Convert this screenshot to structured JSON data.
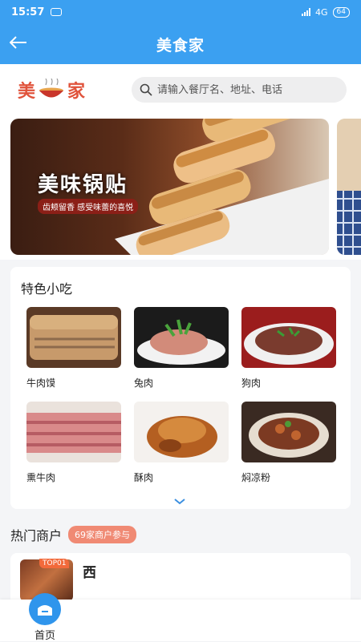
{
  "status_bar": {
    "time": "15:57",
    "network": "4G",
    "battery": "64"
  },
  "app": {
    "title": "美食家"
  },
  "logo": {
    "left": "美",
    "right": "家"
  },
  "search": {
    "placeholder": "请输入餐厅名、地址、电话"
  },
  "banner": {
    "title": "美味锅贴",
    "subtitle": "齿颊留香 感受味蕾的喜悦"
  },
  "snacks": {
    "title": "特色小吃",
    "items": [
      {
        "label": "牛肉馍",
        "icon": "beef-bun-photo"
      },
      {
        "label": "兔肉",
        "icon": "rabbit-meat-photo"
      },
      {
        "label": "狗肉",
        "icon": "dog-meat-photo"
      },
      {
        "label": "熏牛肉",
        "icon": "smoked-beef-photo"
      },
      {
        "label": "酥肉",
        "icon": "crispy-pork-photo"
      },
      {
        "label": "焖凉粉",
        "icon": "braised-jelly-photo"
      }
    ]
  },
  "hot": {
    "title": "热门商户",
    "badge": "69家商户参与"
  },
  "merchant": {
    "rank": "TOP01",
    "name": "西"
  },
  "tabbar": {
    "home_label": "首页"
  },
  "colors": {
    "primary": "#3ba0f1",
    "accent": "#e0533b",
    "badge": "#f08a74"
  }
}
